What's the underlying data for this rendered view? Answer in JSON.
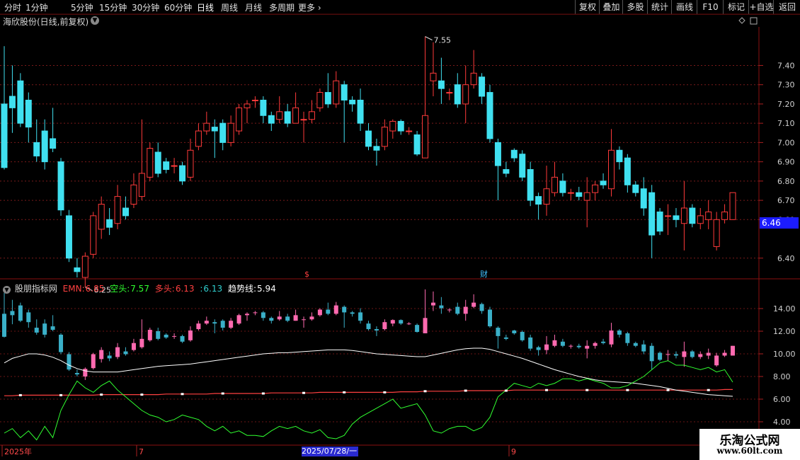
{
  "toolbar": {
    "periods": [
      "分时",
      "1分钟",
      "5分钟",
      "15分钟",
      "30分钟",
      "60分钟",
      "日线",
      "周线",
      "月线",
      "多周期",
      "更多"
    ],
    "active_period": "日线",
    "right_buttons": [
      "复权",
      "叠加",
      "多股",
      "统计",
      "画线",
      "F10",
      "标记",
      "+自选",
      "返回"
    ]
  },
  "main_chart": {
    "title": "海欣股份(日线,前复权)",
    "high_label": "7.55",
    "low_label": "6.25",
    "current_price": "6.46",
    "marker_s": "$",
    "marker_cai": "财",
    "y_axis_ticks": [
      "7.40",
      "7.30",
      "7.20",
      "7.10",
      "7.00",
      "6.90",
      "6.80",
      "6.70",
      "6.60",
      "6.40"
    ],
    "colors": {
      "up": "#ff3a3a",
      "down": "#40e0f0",
      "grid": "#7a1a1a"
    }
  },
  "indicator": {
    "name": "股朋指标网",
    "emn_label": "EMN:",
    "emn_value": "6.85",
    "kongtou_label": "空头:",
    "kongtou_value": "7.57",
    "duotou_label": "多头:",
    "duotou_value": "6.13",
    "extra_label": ":",
    "extra_value": "6.13",
    "trend_label": "趋势线:",
    "trend_value": "5.94",
    "y_axis_ticks": [
      "14.00",
      "12.00",
      "10.00",
      "8.00",
      "6.00",
      "4.00"
    ],
    "colors": {
      "emn": "#ff4040",
      "kongtou": "#30ff30",
      "duotou": "#ff4040",
      "trend": "#ffffff",
      "bar_up": "#ff6ab0",
      "bar_down": "#3ab0c8"
    }
  },
  "x_axis": {
    "labels": [
      "2025年",
      "7",
      "9"
    ],
    "selected_date": "2025/07/28/一"
  },
  "watermark": {
    "line1": "乐淘公式网",
    "line2": "www.60lt.com"
  },
  "chart_data": {
    "type": "candlestick",
    "title": "海欣股份(日线,前复权)",
    "ylim": [
      6.3,
      7.58
    ],
    "candles": [
      [
        7.2,
        6.87,
        7.5,
        6.86
      ],
      [
        7.24,
        7.18,
        7.4,
        7.05
      ],
      [
        7.32,
        7.1,
        7.36,
        7.08
      ],
      [
        7.22,
        7.08,
        7.26,
        7.0
      ],
      [
        7.0,
        6.93,
        7.12,
        6.9
      ],
      [
        7.06,
        6.9,
        7.12,
        6.86
      ],
      [
        7.02,
        6.97,
        7.18,
        6.95
      ],
      [
        6.9,
        6.65,
        6.92,
        6.62
      ],
      [
        6.62,
        6.4,
        6.65,
        6.38
      ],
      [
        6.35,
        6.33,
        6.4,
        6.3
      ],
      [
        6.3,
        6.41,
        6.43,
        6.25
      ],
      [
        6.42,
        6.62,
        6.64,
        6.4
      ],
      [
        6.55,
        6.68,
        6.72,
        6.5
      ],
      [
        6.6,
        6.56,
        6.66,
        6.52
      ],
      [
        6.58,
        6.72,
        6.78,
        6.55
      ],
      [
        6.66,
        6.62,
        6.72,
        6.6
      ],
      [
        6.68,
        6.78,
        6.84,
        6.66
      ],
      [
        6.72,
        6.84,
        7.12,
        6.7
      ],
      [
        6.82,
        6.97,
        7.0,
        6.8
      ],
      [
        6.95,
        6.84,
        7.0,
        6.82
      ],
      [
        6.9,
        6.86,
        6.92,
        6.84
      ],
      [
        6.88,
        6.88,
        6.92,
        6.84
      ],
      [
        6.88,
        6.8,
        6.9,
        6.78
      ],
      [
        6.82,
        6.96,
        7.02,
        6.8
      ],
      [
        6.98,
        7.06,
        7.1,
        6.96
      ],
      [
        7.06,
        7.1,
        7.16,
        7.04
      ],
      [
        7.08,
        7.06,
        7.12,
        6.92
      ],
      [
        7.1,
        7.0,
        7.12,
        6.96
      ],
      [
        7.0,
        7.1,
        7.14,
        6.98
      ],
      [
        7.06,
        7.18,
        7.2,
        7.04
      ],
      [
        7.18,
        7.2,
        7.22,
        7.1
      ],
      [
        7.22,
        7.22,
        7.24,
        7.18
      ],
      [
        7.22,
        7.14,
        7.24,
        7.1
      ],
      [
        7.14,
        7.1,
        7.16,
        7.06
      ],
      [
        7.12,
        7.16,
        7.24,
        7.1
      ],
      [
        7.16,
        7.1,
        7.2,
        7.08
      ],
      [
        7.1,
        7.18,
        7.26,
        7.1
      ],
      [
        7.12,
        7.12,
        7.16,
        7.0
      ],
      [
        7.12,
        7.16,
        7.22,
        7.1
      ],
      [
        7.18,
        7.26,
        7.28,
        7.16
      ],
      [
        7.26,
        7.2,
        7.36,
        7.18
      ],
      [
        7.2,
        7.32,
        7.37,
        7.18
      ],
      [
        7.3,
        7.22,
        7.32,
        7.0
      ],
      [
        7.22,
        7.2,
        7.24,
        7.16
      ],
      [
        7.22,
        7.1,
        7.28,
        7.06
      ],
      [
        7.06,
        6.98,
        7.1,
        6.96
      ],
      [
        6.98,
        6.96,
        7.02,
        6.88
      ],
      [
        6.98,
        7.08,
        7.12,
        6.96
      ],
      [
        7.06,
        7.11,
        7.12,
        7.02
      ],
      [
        7.11,
        7.06,
        7.12,
        7.04
      ],
      [
        7.06,
        7.06,
        7.08,
        7.04
      ],
      [
        7.04,
        6.94,
        7.06,
        6.93
      ],
      [
        6.92,
        7.14,
        7.55,
        6.92
      ],
      [
        7.32,
        7.36,
        7.52,
        7.24
      ],
      [
        7.32,
        7.28,
        7.44,
        7.2
      ],
      [
        7.26,
        7.26,
        7.28,
        7.22
      ],
      [
        7.3,
        7.2,
        7.36,
        7.18
      ],
      [
        7.2,
        7.3,
        7.4,
        7.1
      ],
      [
        7.3,
        7.36,
        7.48,
        7.28
      ],
      [
        7.34,
        7.24,
        7.36,
        7.2
      ],
      [
        7.26,
        7.02,
        7.3,
        7.0
      ],
      [
        7.0,
        6.88,
        7.02,
        6.7
      ],
      [
        6.86,
        6.84,
        6.9,
        6.82
      ],
      [
        6.96,
        6.92,
        6.97,
        6.9
      ],
      [
        6.94,
        6.82,
        6.96,
        6.8
      ],
      [
        6.86,
        6.7,
        6.9,
        6.67
      ],
      [
        6.72,
        6.68,
        6.74,
        6.6
      ],
      [
        6.68,
        6.76,
        6.88,
        6.62
      ],
      [
        6.74,
        6.82,
        6.9,
        6.72
      ],
      [
        6.8,
        6.74,
        6.84,
        6.72
      ],
      [
        6.74,
        6.74,
        6.76,
        6.7
      ],
      [
        6.74,
        6.72,
        6.77,
        6.7
      ],
      [
        6.7,
        6.74,
        6.82,
        6.56
      ],
      [
        6.74,
        6.78,
        6.8,
        6.7
      ],
      [
        6.8,
        6.78,
        6.84,
        6.76
      ],
      [
        6.76,
        6.96,
        7.07,
        6.72
      ],
      [
        6.96,
        6.9,
        6.98,
        6.86
      ],
      [
        6.92,
        6.78,
        6.94,
        6.74
      ],
      [
        6.78,
        6.74,
        6.8,
        6.72
      ],
      [
        6.76,
        6.66,
        6.82,
        6.62
      ],
      [
        6.74,
        6.52,
        6.78,
        6.4
      ],
      [
        6.64,
        6.54,
        6.66,
        6.52
      ],
      [
        6.62,
        6.62,
        6.68,
        6.52
      ],
      [
        6.62,
        6.6,
        6.66,
        6.56
      ],
      [
        6.58,
        6.66,
        6.8,
        6.44
      ],
      [
        6.66,
        6.58,
        6.68,
        6.56
      ],
      [
        6.58,
        6.62,
        6.66,
        6.55
      ],
      [
        6.6,
        6.64,
        6.7,
        6.55
      ],
      [
        6.46,
        6.6,
        6.64,
        6.44
      ],
      [
        6.6,
        6.64,
        6.68,
        6.58
      ],
      [
        6.6,
        6.74,
        6.74,
        6.6
      ]
    ],
    "indicator_lines": {
      "trend": [
        9.2,
        9.6,
        9.8,
        10.0,
        10.0,
        9.9,
        9.7,
        9.4,
        9.0,
        8.7,
        8.5,
        8.4,
        8.4,
        8.4,
        8.4,
        8.5,
        8.6,
        8.7,
        8.8,
        8.9,
        8.95,
        9.0,
        9.05,
        9.1,
        9.2,
        9.3,
        9.4,
        9.5,
        9.6,
        9.7,
        9.8,
        9.9,
        10.0,
        10.05,
        10.1,
        10.1,
        10.15,
        10.2,
        10.25,
        10.3,
        10.35,
        10.35,
        10.35,
        10.3,
        10.2,
        10.1,
        10.0,
        9.95,
        9.9,
        9.85,
        9.8,
        9.75,
        9.75,
        9.9,
        10.05,
        10.2,
        10.35,
        10.45,
        10.5,
        10.5,
        10.4,
        10.2,
        10.0,
        9.8,
        9.6,
        9.35,
        9.1,
        8.85,
        8.6,
        8.4,
        8.2,
        8.0,
        7.85,
        7.7,
        7.6,
        7.55,
        7.5,
        7.45,
        7.4,
        7.3,
        7.2,
        7.1,
        6.95,
        6.8,
        6.7,
        6.6,
        6.5,
        6.4,
        6.35,
        6.3,
        6.25
      ],
      "kongtou": [
        3.0,
        3.4,
        2.6,
        3.2,
        2.4,
        3.6,
        2.6,
        5.0,
        6.4,
        7.6,
        7.0,
        6.6,
        7.2,
        7.6,
        6.8,
        6.2,
        5.6,
        5.0,
        4.6,
        4.4,
        4.0,
        4.2,
        4.6,
        4.4,
        4.2,
        3.6,
        3.2,
        3.6,
        3.0,
        3.2,
        2.8,
        2.8,
        2.7,
        3.2,
        3.6,
        3.4,
        3.6,
        3.2,
        3.0,
        3.3,
        2.6,
        2.5,
        2.8,
        3.8,
        4.4,
        4.8,
        5.2,
        5.6,
        6.0,
        5.2,
        5.4,
        5.6,
        4.6,
        3.2,
        3.0,
        3.4,
        3.6,
        3.6,
        3.2,
        3.5,
        4.4,
        6.2,
        6.8,
        7.4,
        7.2,
        7.0,
        7.4,
        7.2,
        7.4,
        7.8,
        7.8,
        7.6,
        7.8,
        7.6,
        7.4,
        7.0,
        7.0,
        7.2,
        7.6,
        8.0,
        8.6,
        9.2,
        9.4,
        9.0,
        9.0,
        8.8,
        8.6,
        8.8,
        8.4,
        8.6,
        7.5
      ],
      "emn": [
        6.3,
        6.3,
        6.35,
        6.35,
        6.35,
        6.35,
        6.35,
        6.35,
        6.35,
        6.35,
        6.35,
        6.35,
        6.4,
        6.4,
        6.4,
        6.4,
        6.4,
        6.4,
        6.4,
        6.4,
        6.45,
        6.45,
        6.45,
        6.45,
        6.45,
        6.45,
        6.5,
        6.5,
        6.5,
        6.5,
        6.5,
        6.5,
        6.5,
        6.55,
        6.55,
        6.55,
        6.55,
        6.55,
        6.55,
        6.6,
        6.6,
        6.6,
        6.6,
        6.6,
        6.6,
        6.6,
        6.6,
        6.6,
        6.6,
        6.65,
        6.65,
        6.65,
        6.7,
        6.7,
        6.7,
        6.7,
        6.7,
        6.75,
        6.75,
        6.75,
        6.75,
        6.75,
        6.75,
        6.8,
        6.8,
        6.8,
        6.8,
        6.8,
        6.8,
        6.8,
        6.8,
        6.8,
        6.8,
        6.8,
        6.8,
        6.8,
        6.8,
        6.8,
        6.8,
        6.8,
        6.8,
        6.8,
        6.8,
        6.8,
        6.8,
        6.8,
        6.8,
        6.8,
        6.8,
        6.85,
        6.85
      ]
    }
  }
}
